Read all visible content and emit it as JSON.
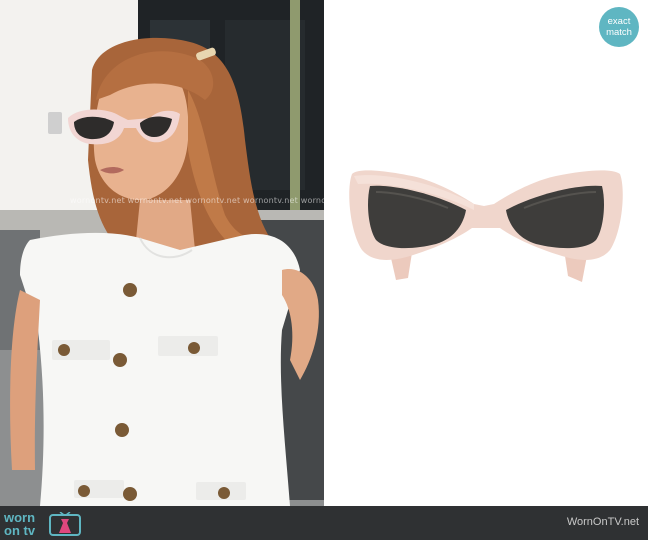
{
  "badge": {
    "line1": "exact",
    "line2": "match"
  },
  "watermark": {
    "text": "wornontv.net wornontv.net wornontv.net wornontv.net wornontv"
  },
  "footer": {
    "logo_top": "worn",
    "logo_bottom": "on tv",
    "site_label": "WornOnTV.net"
  },
  "colors": {
    "accent": "#5fb6c2",
    "footer_bg": "#2f3133",
    "frame": "#f0d6cc",
    "lens": "#3e3d3b"
  },
  "icons": {
    "logo": "tv-dress-icon"
  }
}
